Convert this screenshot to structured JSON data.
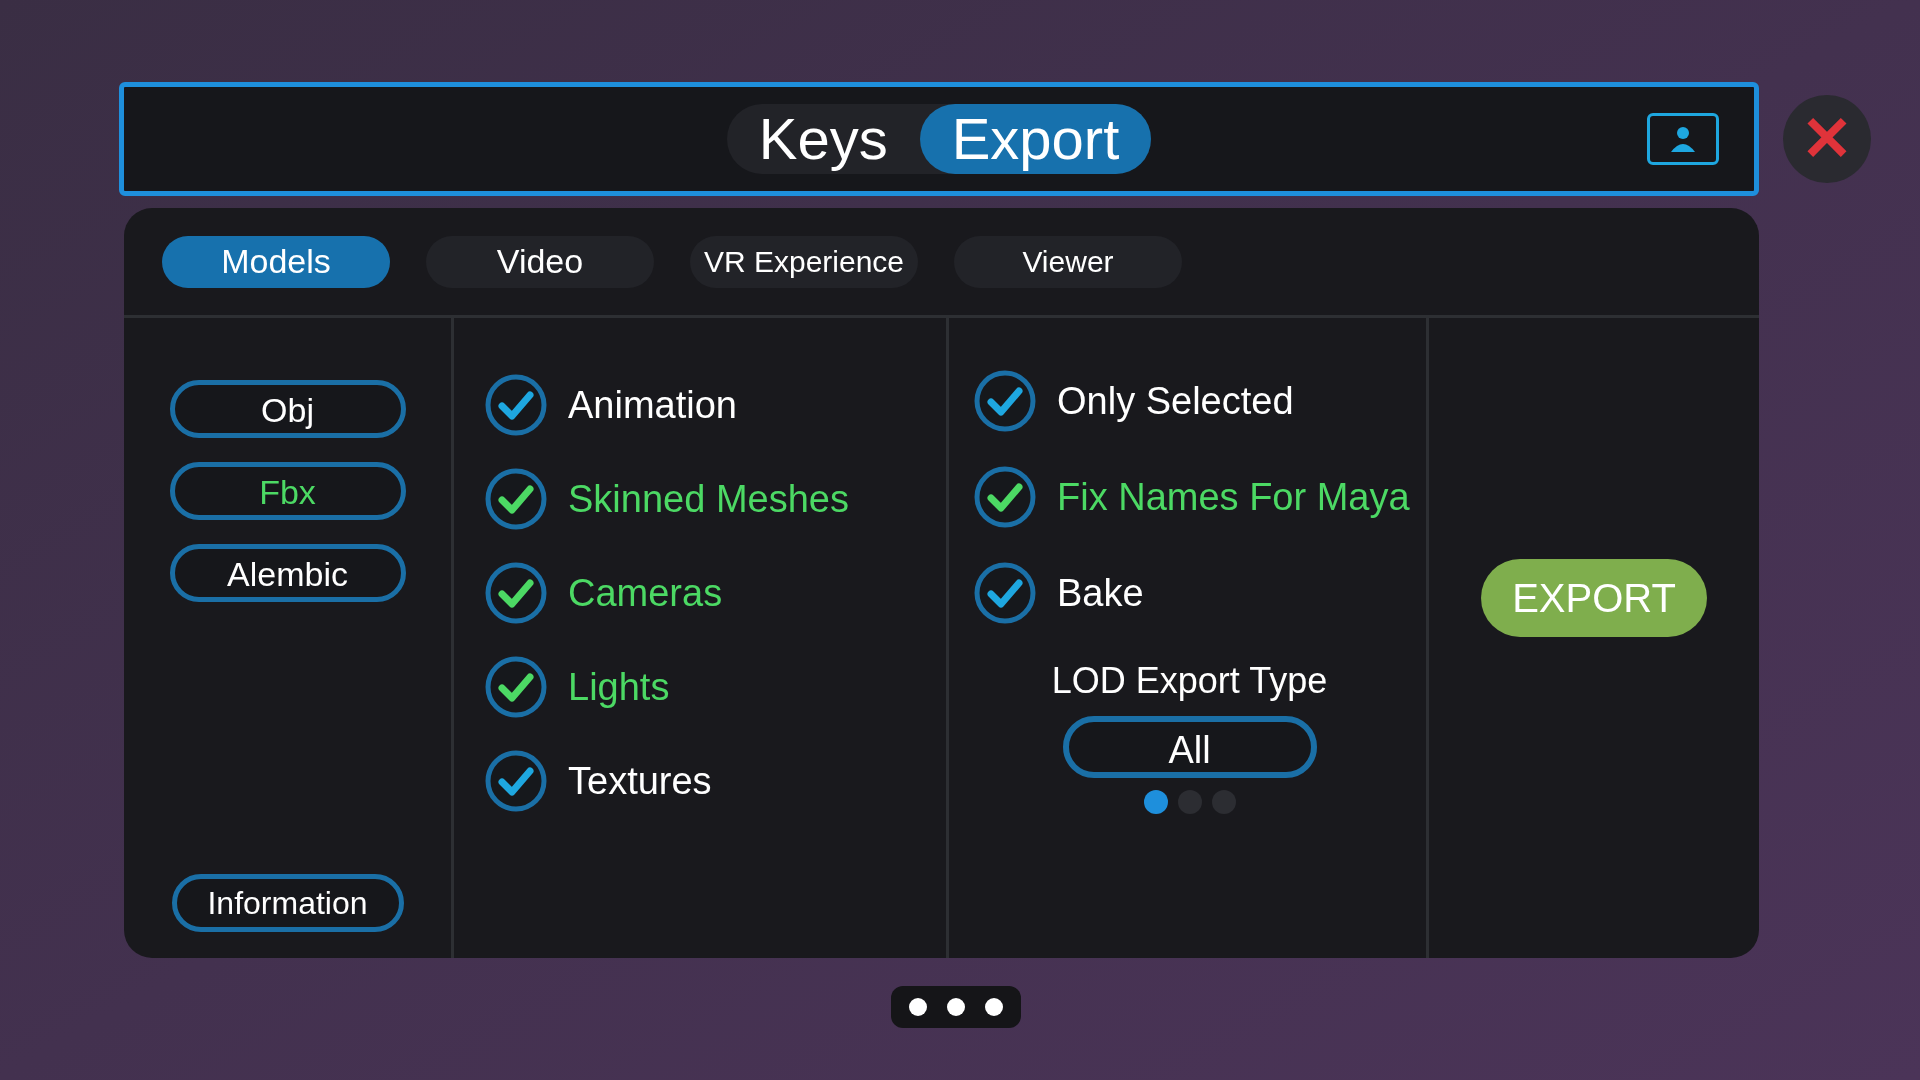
{
  "header_tabs": [
    {
      "label": "Keys",
      "selected": false
    },
    {
      "label": "Export",
      "selected": true
    }
  ],
  "close_button": "✕",
  "tabs": [
    {
      "label": "Models",
      "selected": true
    },
    {
      "label": "Video",
      "selected": false
    },
    {
      "label": "VR Experience",
      "selected": false
    },
    {
      "label": "Viewer",
      "selected": false
    }
  ],
  "formats": [
    {
      "label": "Obj",
      "selected": false
    },
    {
      "label": "Fbx",
      "selected": true
    },
    {
      "label": "Alembic",
      "selected": false
    }
  ],
  "information_button": "Information",
  "options_left": [
    {
      "label": "Animation",
      "checked": true,
      "highlighted": false
    },
    {
      "label": "Skinned Meshes",
      "checked": true,
      "highlighted": true
    },
    {
      "label": "Cameras",
      "checked": true,
      "highlighted": true
    },
    {
      "label": "Lights",
      "checked": true,
      "highlighted": true
    },
    {
      "label": "Textures",
      "checked": true,
      "highlighted": false
    }
  ],
  "options_right": [
    {
      "label": "Only Selected",
      "checked": true,
      "highlighted": false
    },
    {
      "label": "Fix Names For Maya",
      "checked": true,
      "highlighted": true
    },
    {
      "label": "Bake",
      "checked": true,
      "highlighted": false
    }
  ],
  "lod": {
    "label": "LOD Export Type",
    "value": "All",
    "pages": [
      {
        "selected": true
      },
      {
        "selected": false
      },
      {
        "selected": false
      }
    ]
  },
  "export_button": "EXPORT",
  "bottom_pages": [
    {
      "selected": false
    },
    {
      "selected": false
    },
    {
      "selected": false
    }
  ]
}
